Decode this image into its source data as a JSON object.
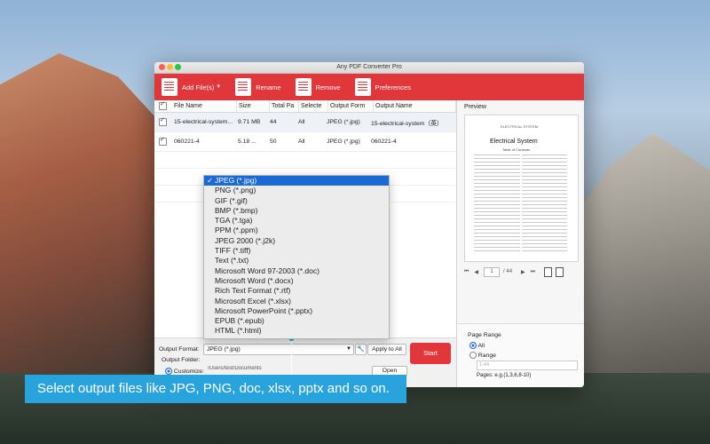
{
  "window": {
    "title": "Any PDF Converter Pro"
  },
  "toolbar": {
    "add_files": "Add File(s)",
    "rename": "Rename",
    "remove": "Remove",
    "preferences": "Preferences"
  },
  "table": {
    "headers": [
      "File Name",
      "Size",
      "Total Pa",
      "Selecte",
      "Output Form",
      "Output Name"
    ],
    "rows": [
      {
        "name": "15-electrical-system...",
        "size": "9.71 MB",
        "total": "44",
        "selected": "All",
        "format": "JPEG (*.jpg)",
        "output": "15-electrical-system（英）"
      },
      {
        "name": "060221-4",
        "size": "5.18 ...",
        "total": "50",
        "selected": "All",
        "format": "JPEG (*.jpg)",
        "output": "060221-4"
      }
    ]
  },
  "dropdown": {
    "options": [
      "JPEG (*.jpg)",
      "PNG (*.png)",
      "GIF (*.gif)",
      "BMP (*.bmp)",
      "TGA (*.tga)",
      "PPM (*.ppm)",
      "JPEG 2000 (*.j2k)",
      "TIFF (*.tiff)",
      "Text (*.txt)",
      "Microsoft Word 97-2003 (*.doc)",
      "Microsoft Word (*.docx)",
      "Rich Text Format (*.rtf)",
      "Microsoft Excel (*.xlsx)",
      "Microsoft PowerPoint (*.pptx)",
      "EPUB (*.epub)",
      "HTML (*.html)"
    ],
    "selected": "JPEG (*.jpg)"
  },
  "bottom": {
    "output_format_label": "Output Format:",
    "output_format_value": "JPEG (*.jpg)",
    "apply_to_all": "Apply to All",
    "output_folder_label": "Output Folder:",
    "customize_label": "Customize:",
    "customize_path": "/Users/test/Documents",
    "open": "Open",
    "start": "Start"
  },
  "preview": {
    "label": "Preview",
    "page_header": "ELECTRICAL SYSTEM",
    "page_title": "Electrical System",
    "page_subtitle": "Table of Contents",
    "current_page": "1",
    "total_pages": "/ 44"
  },
  "page_range": {
    "label": "Page Range",
    "all": "All",
    "range": "Range",
    "range_placeholder": "1-44",
    "hint": "Pages: e.g.(1,3,6,8-10)"
  },
  "callout": {
    "text": "Select output files like JPG, PNG, doc, xlsx, pptx and so on."
  }
}
